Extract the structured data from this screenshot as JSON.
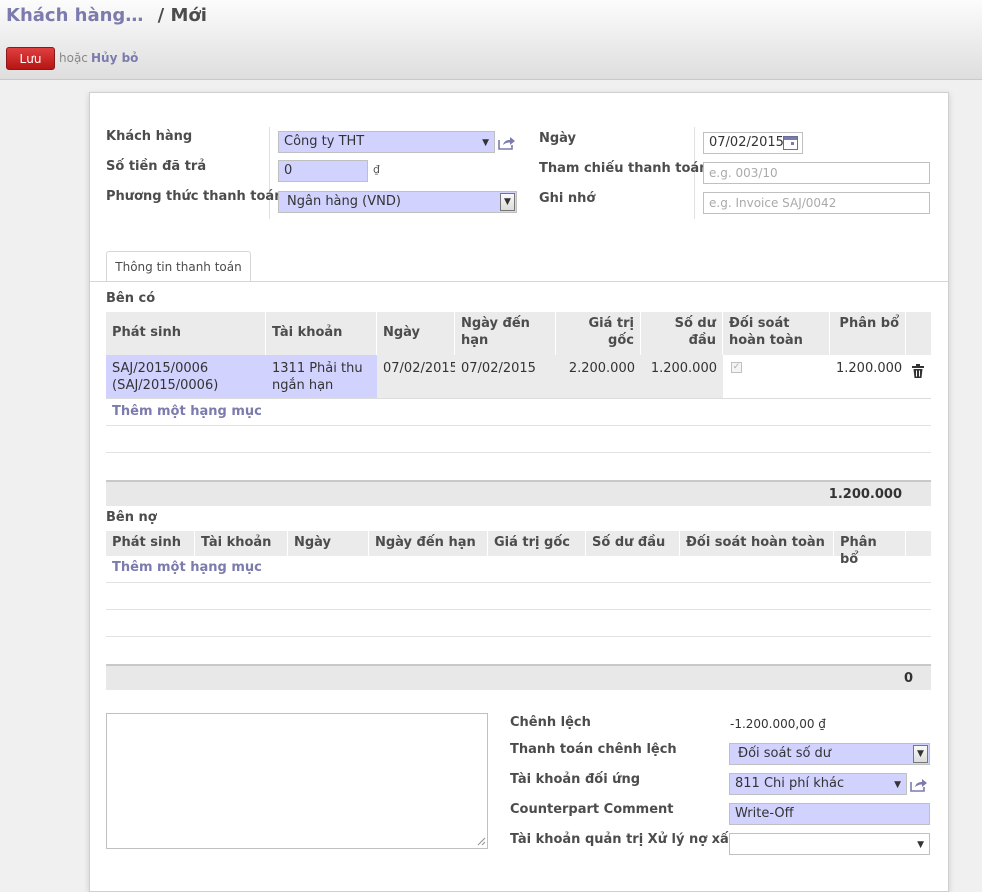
{
  "breadcrumb": {
    "parent": "Khách hàng…",
    "separator": "/",
    "current": "Mới"
  },
  "toolbar": {
    "save_label": "Lưu",
    "or_text": "hoặc",
    "discard_label": "Hủy bỏ"
  },
  "form": {
    "partner": {
      "label": "Khách hàng",
      "value": "Công ty THT"
    },
    "amount": {
      "label": "Số tiền đã trả",
      "value": "0",
      "currency": "₫"
    },
    "journal": {
      "label": "Phương thức thanh toán",
      "value": "Ngân hàng (VND)"
    },
    "date": {
      "label": "Ngày",
      "value": "07/02/2015"
    },
    "reference": {
      "label": "Tham chiếu thanh toán",
      "value": "",
      "placeholder": "e.g. 003/10"
    },
    "memo": {
      "label": "Ghi nhớ",
      "value": "",
      "placeholder": "e.g. Invoice SAJ/0042"
    }
  },
  "tabs": [
    {
      "label": "Thông tin thanh toán"
    }
  ],
  "credits": {
    "title": "Bên có",
    "columns": [
      "Phát sinh",
      "Tài khoản",
      "Ngày",
      "Ngày đến hạn",
      "Giá trị gốc",
      "Số dư đầu",
      "Đối soát hoàn toàn",
      "Phân bổ"
    ],
    "rows": [
      {
        "move_line": "SAJ/2015/0006 (SAJ/2015/0006)",
        "account": "1311 Phải thu ngắn hạn",
        "date": "07/02/2015",
        "due_date": "07/02/2015",
        "original": "2.200.000",
        "open_balance": "1.200.000",
        "full_reconcile": true,
        "allocation": "1.200.000"
      }
    ],
    "add_item": "Thêm một hạng mục",
    "total": "1.200.000"
  },
  "debits": {
    "title": "Bên nợ",
    "columns": [
      "Phát sinh",
      "Tài khoản",
      "Ngày",
      "Ngày đến hạn",
      "Giá trị gốc",
      "Số dư đầu",
      "Đối soát hoàn toàn",
      "Phân bổ"
    ],
    "add_item": "Thêm một hạng mục",
    "total": "0"
  },
  "writeoff": {
    "difference": {
      "label": "Chênh lệch",
      "value": "-1.200.000,00 ₫"
    },
    "payment_difference": {
      "label": "Thanh toán chênh lệch",
      "value": "Đối soát số dư"
    },
    "counter_account": {
      "label": "Tài khoản đối ứng",
      "value": "811 Chi phí khác"
    },
    "counter_comment": {
      "label": "Counterpart Comment",
      "value": "Write-Off"
    },
    "analytic_account": {
      "label": "Tài khoản quản trị Xử lý nợ xấu",
      "value": ""
    }
  },
  "colors": {
    "accent": "#7c7bad",
    "required": "#d2d2ff",
    "save_button": "#c81d1d"
  }
}
